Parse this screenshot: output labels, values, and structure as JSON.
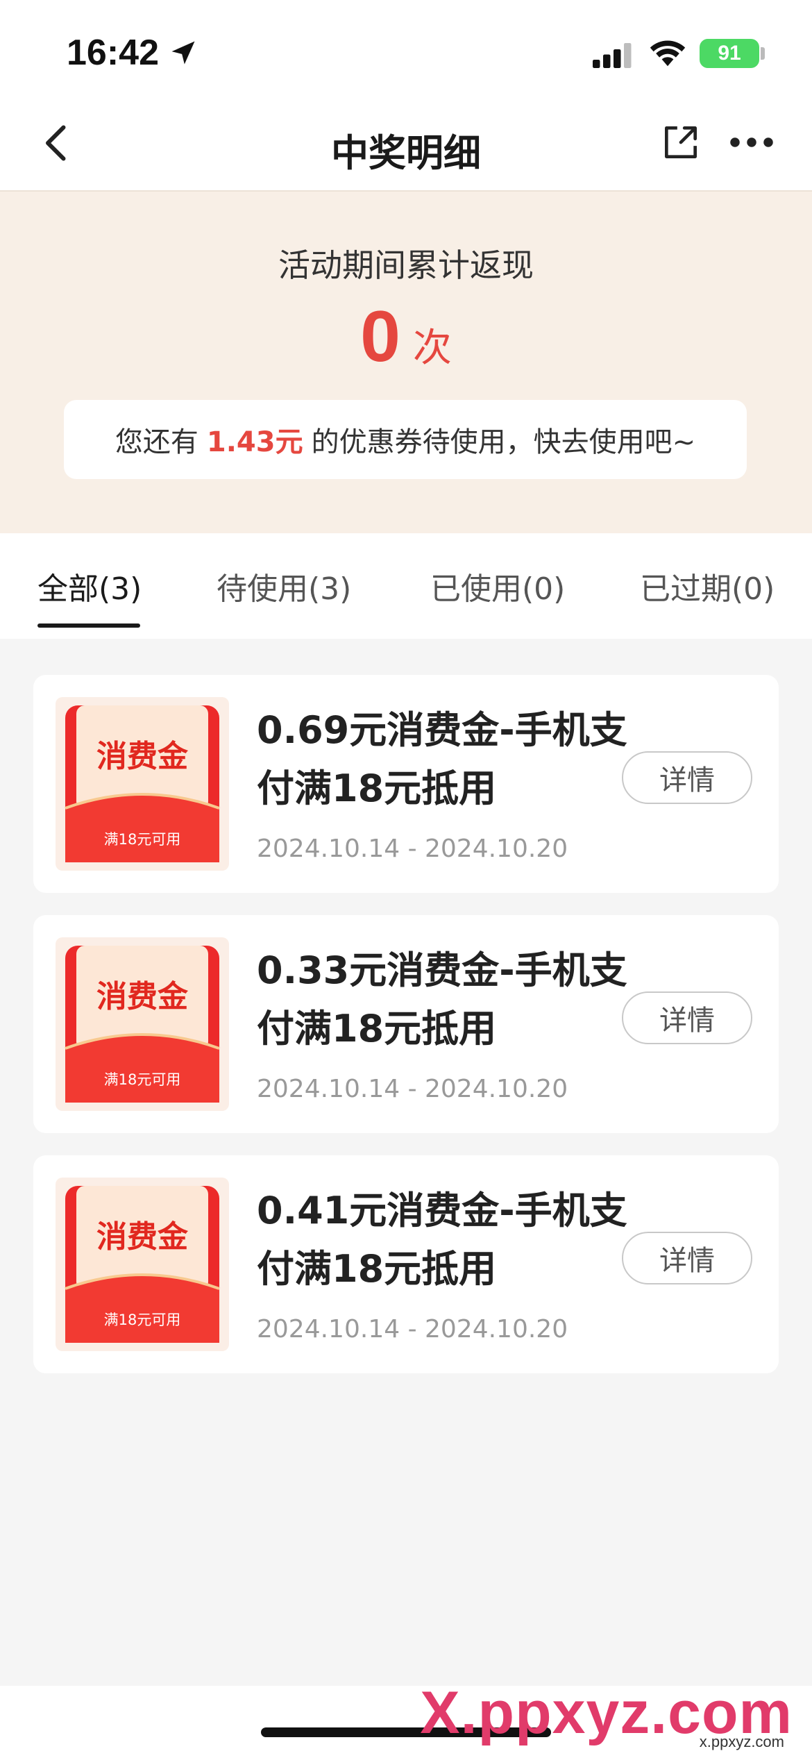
{
  "status_bar": {
    "time": "16:42",
    "battery": "91"
  },
  "header": {
    "title": "中奖明细"
  },
  "summary": {
    "label": "活动期间累计返现",
    "count": "0",
    "count_unit": "次",
    "note_prefix": "您还有",
    "note_amount": "1.43元",
    "note_suffix": "的优惠券待使用，快去使用吧~"
  },
  "tabs": [
    {
      "label": "全部(3)",
      "active": true
    },
    {
      "label": "待使用(3)",
      "active": false
    },
    {
      "label": "已使用(0)",
      "active": false
    },
    {
      "label": "已过期(0)",
      "active": false
    }
  ],
  "coupons": [
    {
      "badge": "消费金",
      "badge_sub": "满18元可用",
      "title": "0.69元消费金-手机支付满18元抵用",
      "date": "2024.10.14 - 2024.10.20",
      "button": "详情"
    },
    {
      "badge": "消费金",
      "badge_sub": "满18元可用",
      "title": "0.33元消费金-手机支付满18元抵用",
      "date": "2024.10.14 - 2024.10.20",
      "button": "详情"
    },
    {
      "badge": "消费金",
      "badge_sub": "满18元可用",
      "title": "0.41元消费金-手机支付满18元抵用",
      "date": "2024.10.14 - 2024.10.20",
      "button": "详情"
    }
  ],
  "watermark": {
    "main": "X.ppxyz.com",
    "sub": "x.ppxyz.com"
  },
  "colors": {
    "accent_red": "#e5473f",
    "summary_bg": "#f8efe6",
    "page_bg": "#f5f5f5"
  }
}
